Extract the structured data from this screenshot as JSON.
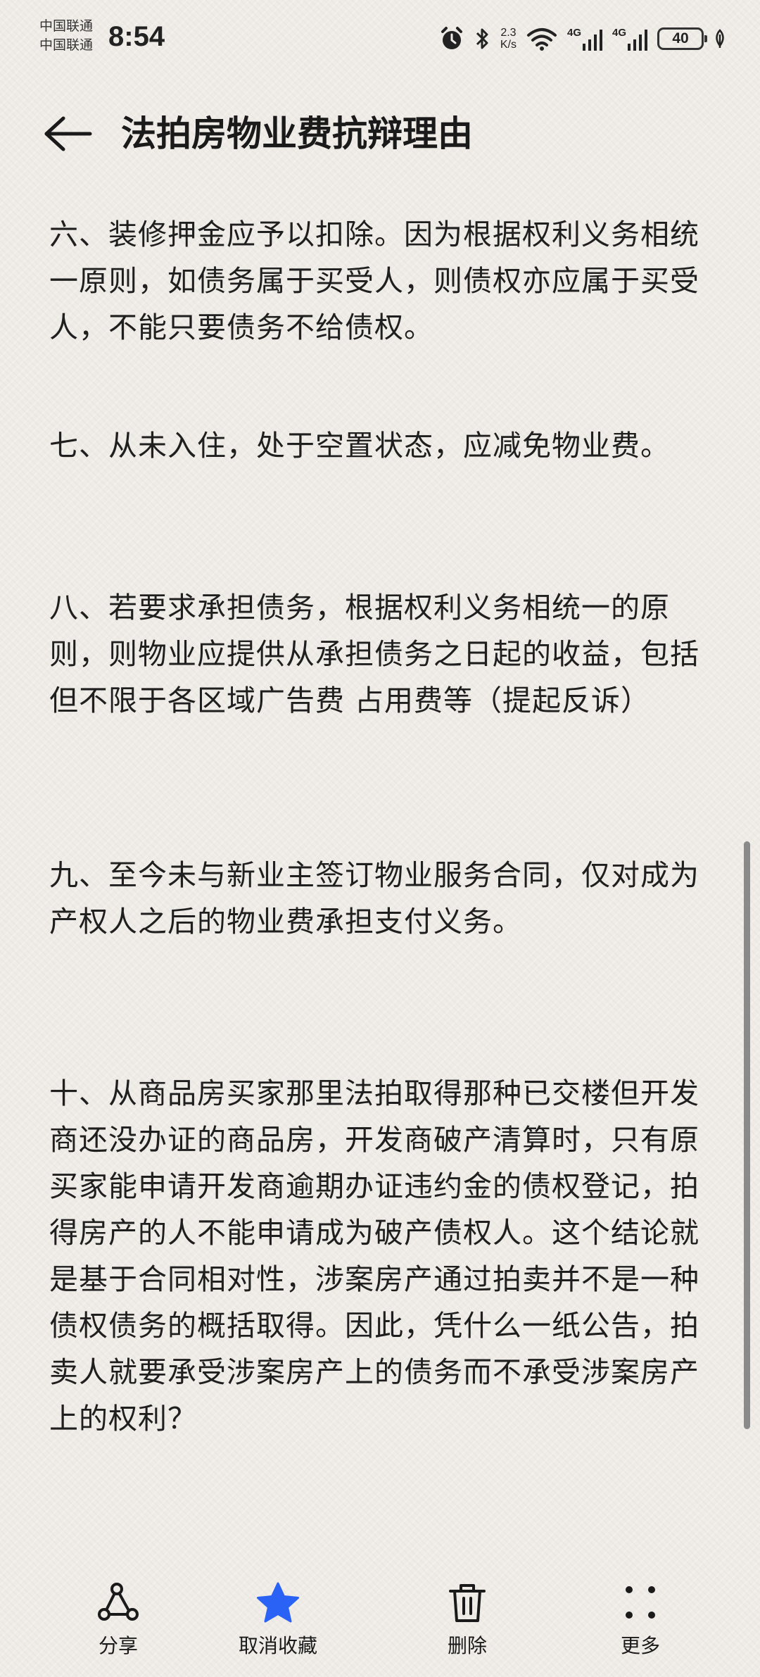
{
  "status_bar": {
    "carrier_1": "中国联通",
    "carrier_2": "中国联通",
    "time": "8:54",
    "net_speed_value": "2.3",
    "net_speed_unit": "K/s",
    "signal_1_label": "4G",
    "signal_2_label": "4G",
    "battery": "40",
    "icons": [
      "alarm-icon",
      "bluetooth-icon",
      "wifi-icon",
      "signal-icon",
      "battery-icon",
      "leaf-icon"
    ]
  },
  "header": {
    "title": "法拍房物业费抗辩理由"
  },
  "paragraphs": [
    "六、装修押金应予以扣除。因为根据权利义务相统一原则，如债务属于买受人，则债权亦应属于买受人，不能只要债务不给债权。",
    "七、从未入住，处于空置状态，应减免物业费。",
    "八、若要求承担债务，根据权利义务相统一的原则，则物业应提供从承担债务之日起的收益，包括但不限于各区域广告费  占用费等（提起反诉）",
    "九、至今未与新业主签订物业服务合同，仅对成为产权人之后的物业费承担支付义务。",
    "十、从商品房买家那里法拍取得那种已交楼但开发商还没办证的商品房，开发商破产清算时，只有原买家能申请开发商逾期办证违约金的债权登记，拍得房产的人不能申请成为破产债权人。这个结论就是基于合同相对性，涉案房产通过拍卖并不是一种债权债务的概括取得。因此，凭什么一纸公告，拍卖人就要承受涉案房产上的债务而不承受涉案房产上的权利？"
  ],
  "toolbar": {
    "share": "分享",
    "unfavorite": "取消收藏",
    "delete": "删除",
    "more": "更多"
  },
  "colors": {
    "background": "#efebe6",
    "text": "#1f1f1f",
    "favorite_star": "#2a62f5"
  }
}
